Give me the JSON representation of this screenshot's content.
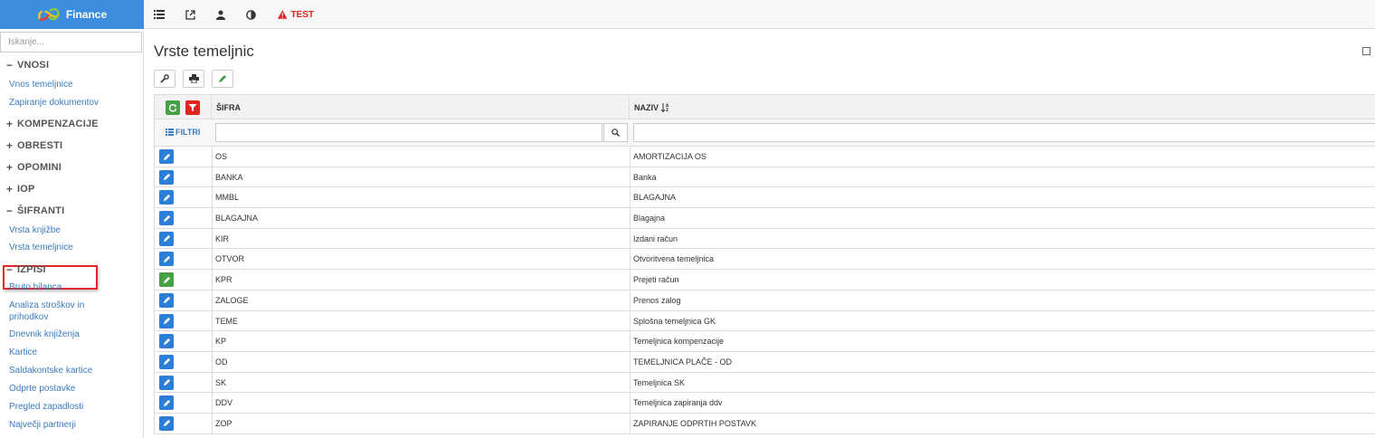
{
  "app": {
    "brand": "Finance",
    "colors": {
      "brand": "#3c8dde",
      "link": "#3a7bbf",
      "edit_button": "#2b7fd6",
      "active_edit": "#46a046",
      "danger": "#e0261f",
      "highlight": "#e0282a"
    }
  },
  "toolbar": {
    "icons": [
      "list-icon",
      "external-link-icon",
      "user-icon",
      "contrast-icon"
    ],
    "test_label": "TEST"
  },
  "sidebar": {
    "search_placeholder": "Iskanje...",
    "sections": [
      {
        "sign": "−",
        "label": "VNOSI",
        "expanded": true
      },
      {
        "sign": "+",
        "label": "KOMPENZACIJE",
        "expanded": false
      },
      {
        "sign": "+",
        "label": "OBRESTI",
        "expanded": false
      },
      {
        "sign": "+",
        "label": "OPOMINI",
        "expanded": false
      },
      {
        "sign": "+",
        "label": "IOP",
        "expanded": false
      },
      {
        "sign": "−",
        "label": "ŠIFRANTI",
        "expanded": true
      },
      {
        "sign": "−",
        "label": "IZPISI",
        "expanded": true
      }
    ],
    "vnosi_items": [
      "Vnos temeljnice",
      "Zapiranje dokumentov"
    ],
    "sifranti_items": [
      "Vrsta knjižbe",
      "Vrsta temeljnice"
    ],
    "izpisi_items": [
      "Bruto bilanca",
      "Analiza stroškov in",
      "prihodkov",
      "Dnevnik knjiženja",
      "Kartice",
      "Saldakontske kartice",
      "Odprte postavke",
      "Pregled zapadlosti",
      "Največji partnerji"
    ],
    "active_item": "Vrsta temeljnice"
  },
  "main": {
    "title": "Vrste temeljnic",
    "tools": [
      "wrench-icon",
      "print-icon",
      "pencil-icon"
    ],
    "grid": {
      "columns": {
        "sifra": "ŠIFRA",
        "naziv": "NAZIV",
        "sort_icon": "sort-alpha-down-icon"
      },
      "filter_label": "FILTRI",
      "rows": [
        {
          "sifra": "OS",
          "naziv": "AMORTIZACIJA OS",
          "selected": false
        },
        {
          "sifra": "BANKA",
          "naziv": "Banka",
          "selected": false
        },
        {
          "sifra": "MMBL",
          "naziv": "BLAGAJNA",
          "selected": false
        },
        {
          "sifra": "BLAGAJNA",
          "naziv": "Blagajna",
          "selected": false
        },
        {
          "sifra": "KIR",
          "naziv": "Izdani račun",
          "selected": false
        },
        {
          "sifra": "OTVOR",
          "naziv": "Otvoritvena temeljnica",
          "selected": false
        },
        {
          "sifra": "KPR",
          "naziv": "Prejeti račun",
          "selected": true
        },
        {
          "sifra": "ZALOGE",
          "naziv": "Prenos zalog",
          "selected": false
        },
        {
          "sifra": "TEME",
          "naziv": "Splošna temeljnica GK",
          "selected": false
        },
        {
          "sifra": "KP",
          "naziv": "Temeljnica kompenzacije",
          "selected": false
        },
        {
          "sifra": "OD",
          "naziv": "TEMELJNICA PLAČE - OD",
          "selected": false
        },
        {
          "sifra": "SK",
          "naziv": "Temeljnica SK",
          "selected": false
        },
        {
          "sifra": "DDV",
          "naziv": "Temeljnica zapiranja ddv",
          "selected": false
        },
        {
          "sifra": "ZOP",
          "naziv": "ZAPIRANJE ODPRTIH POSTAVK",
          "selected": false
        }
      ]
    }
  }
}
